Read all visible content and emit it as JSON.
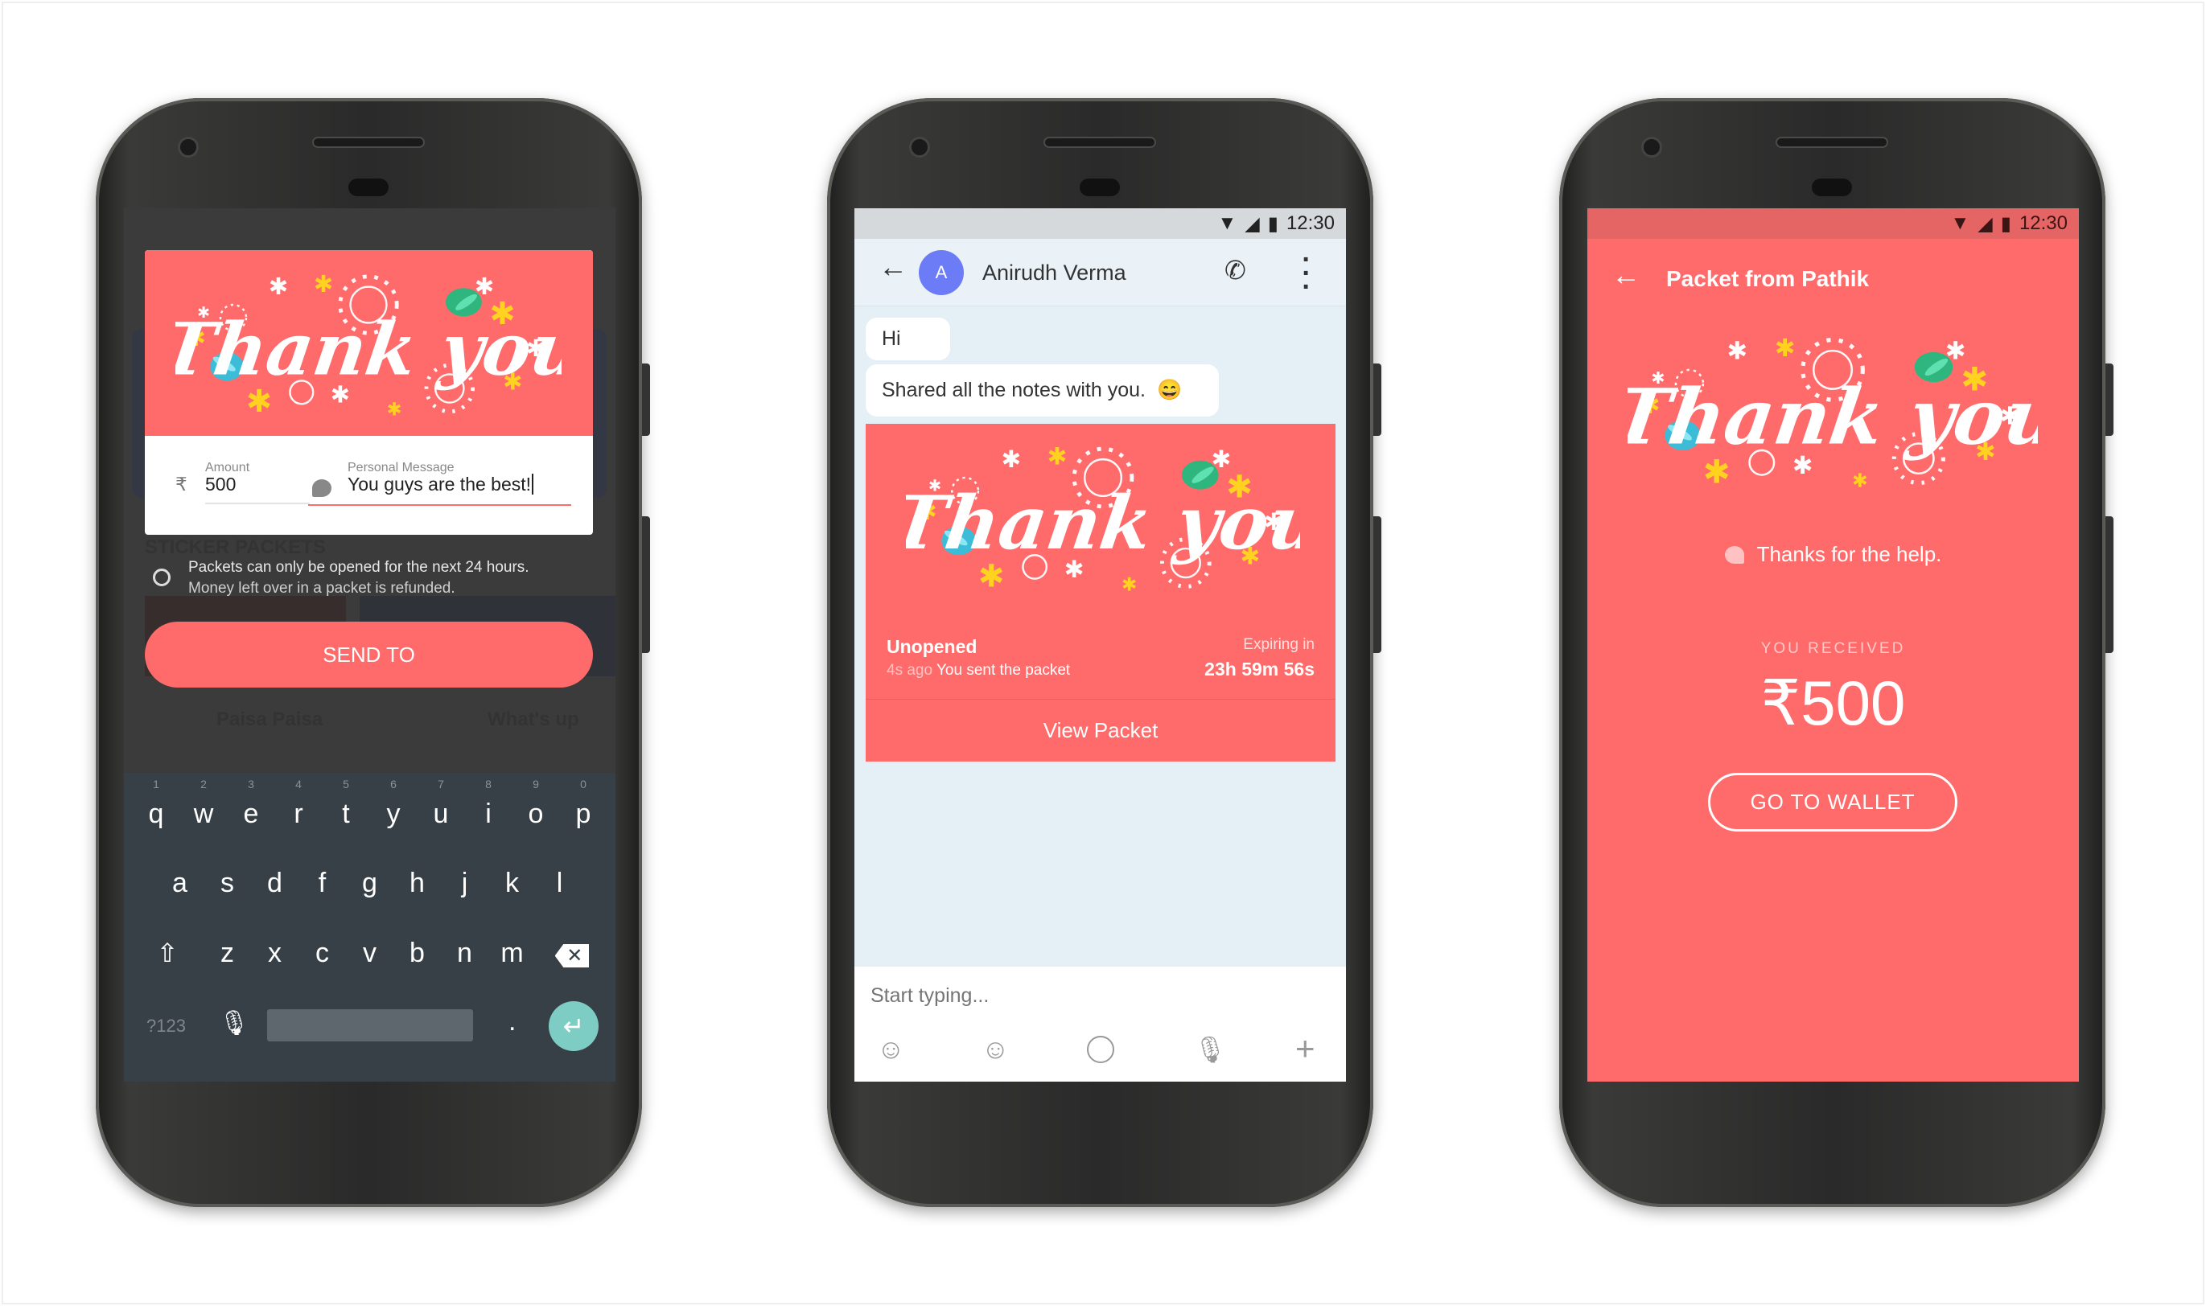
{
  "art": {
    "text": "Thank you",
    "colors": {
      "card": "#ff6b6b",
      "star_yellow": "#ffd21f",
      "butterfly_green": "#2fb57e",
      "butterfly_blue": "#3cbcd6"
    }
  },
  "create_packet": {
    "background_labels": {
      "section": "STICKER PACKETS",
      "sticker1": "Paisa Paisa",
      "sticker2": "What's up"
    },
    "amount_label": "Amount",
    "currency_symbol": "₹",
    "amount_value": "500",
    "message_label": "Personal Message",
    "message_value": "You guys are the best!",
    "info_line1": "Packets can only be opened for the next 24 hours.",
    "info_line2": "Money left over in a packet is refunded.",
    "send_button": "SEND TO",
    "keyboard": {
      "row1": [
        "q",
        "w",
        "e",
        "r",
        "t",
        "y",
        "u",
        "i",
        "o",
        "p"
      ],
      "hints": [
        "1",
        "2",
        "3",
        "4",
        "5",
        "6",
        "7",
        "8",
        "9",
        "0"
      ],
      "row2": [
        "a",
        "s",
        "d",
        "f",
        "g",
        "h",
        "j",
        "k",
        "l"
      ],
      "row3": [
        "z",
        "x",
        "c",
        "v",
        "b",
        "n",
        "m"
      ],
      "symbols_key": "?123",
      "period_key": ".",
      "enter_color": "#7ecdc4"
    }
  },
  "chat": {
    "status_time": "12:30",
    "contact_initial": "A",
    "contact_name": "Anirudh Verma",
    "avatar_color": "#6b7cf6",
    "messages": [
      "Hi",
      "Shared all the notes with you."
    ],
    "emoji": "😄",
    "packet": {
      "status": "Unopened",
      "time_ago": "4s ago",
      "sent_text": "You sent the packet",
      "expiring_label": "Expiring in",
      "expiring_value": "23h 59m 56s",
      "view_button": "View Packet"
    },
    "input_placeholder": "Start typing..."
  },
  "received": {
    "status_time": "12:30",
    "title": "Packet from Pathik",
    "message": "Thanks for the help.",
    "received_label": "YOU RECEIVED",
    "amount": "₹500",
    "wallet_button": "GO TO  WALLET"
  }
}
